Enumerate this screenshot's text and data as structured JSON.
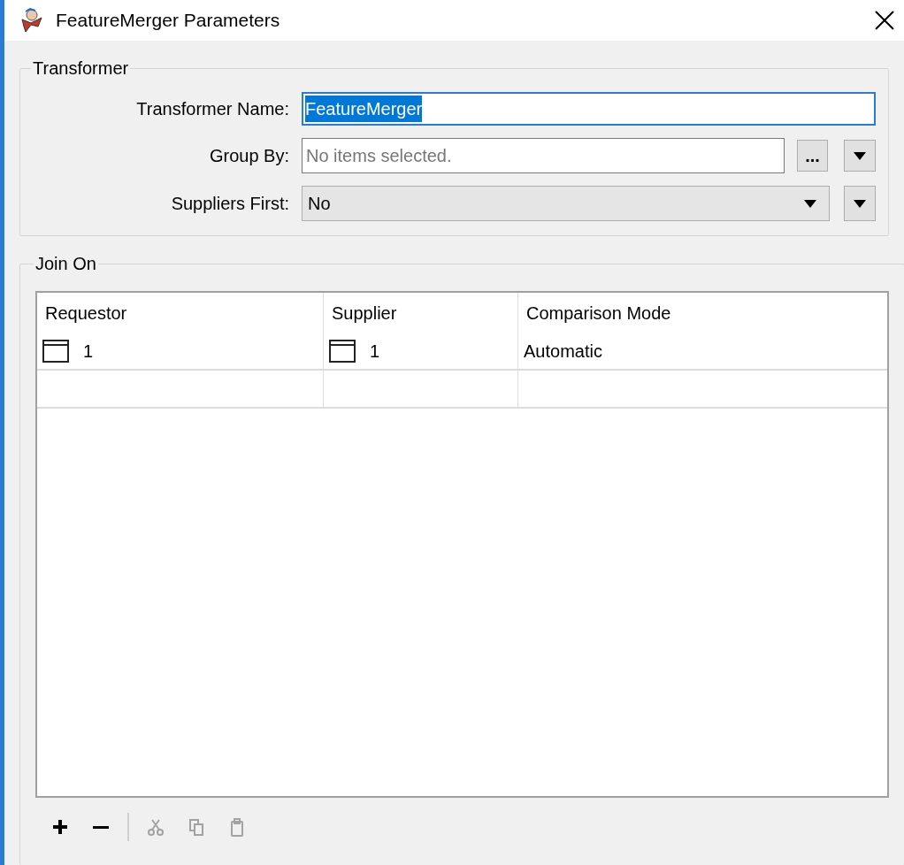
{
  "window": {
    "title": "FeatureMerger Parameters"
  },
  "transformer": {
    "legend": "Transformer",
    "name": {
      "label": "Transformer Name:",
      "value": "FeatureMerger",
      "selected": true
    },
    "group_by": {
      "label": "Group By:",
      "placeholder": "No items selected.",
      "browse_button": "..."
    },
    "suppliers_first": {
      "label": "Suppliers First:",
      "value": "No"
    }
  },
  "join_on": {
    "legend": "Join On",
    "table": {
      "columns": [
        "Requestor",
        "Supplier",
        "Comparison Mode"
      ],
      "rows": [
        {
          "requestor": "1",
          "supplier": "1",
          "mode": "Automatic"
        },
        {
          "requestor": "",
          "supplier": "",
          "mode": ""
        }
      ]
    },
    "toolbar": [
      {
        "kind": "add",
        "disabled": false
      },
      {
        "kind": "remove",
        "disabled": false
      },
      {
        "kind": "separator"
      },
      {
        "kind": "cut",
        "disabled": true
      },
      {
        "kind": "copy",
        "disabled": true
      },
      {
        "kind": "paste",
        "disabled": true
      }
    ]
  }
}
